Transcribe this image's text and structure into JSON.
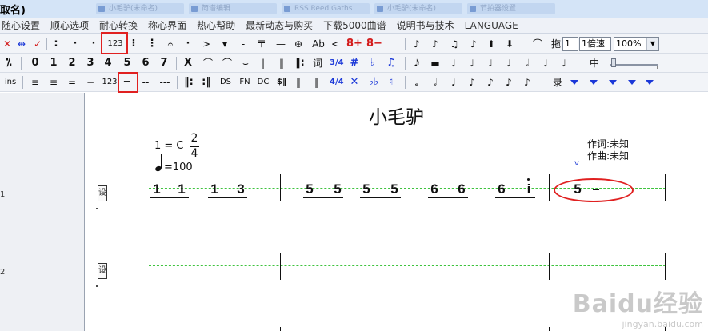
{
  "window": {
    "title": "取名)"
  },
  "ghost_tabs": [
    "小毛驴(未命名)",
    "简谱编辑",
    "RSS Reed Gaths",
    "小毛驴(未命名)",
    "节拍器设置"
  ],
  "menu": [
    "随心设置",
    "顺心选项",
    "耐心转换",
    "称心界面",
    "热心帮助",
    "最新动态与购买",
    "下载5000曲谱",
    "说明书与技术",
    "LANGUAGE"
  ],
  "toolbar1": {
    "left_icons": [
      "delete-x-icon",
      "cut-icon",
      "check-icon"
    ],
    "dots": [
      ":",
      "·",
      "·"
    ],
    "numbered_mode": "123",
    "marks": [
      "⁝",
      "⋮",
      "𝄐",
      "·",
      ">",
      "▾",
      "-",
      "〒",
      "—",
      "⊕",
      "Ab",
      "<"
    ],
    "octave_up": "8+",
    "octave_down": "8−",
    "drag_label": "拖",
    "drag_value": "1",
    "speed_value": "1倍速",
    "zoom": "100%"
  },
  "toolbar2": {
    "first": "⁒",
    "digits": [
      "0",
      "1",
      "2",
      "3",
      "4",
      "5",
      "6",
      "7"
    ],
    "marks": [
      "X",
      "⌒",
      "⌒",
      "⌣",
      "|",
      "‖",
      "‖:",
      "词",
      "3/4",
      "#",
      "♭",
      "♫"
    ],
    "voice_label": "中"
  },
  "toolbar3": {
    "ins": "ins",
    "lines": [
      "≡",
      "≡",
      "=",
      "−"
    ],
    "numbered_small": "123",
    "dash": "−",
    "dash2": "--",
    "dash3": "---",
    "marks": [
      "‖:",
      ":‖",
      "DS",
      "FN",
      "DC",
      "$‖",
      "‖",
      "‖",
      "4/4",
      "✕",
      "♭♭",
      "♮"
    ],
    "record_label": "录"
  },
  "score": {
    "title": "小毛驴",
    "key": "1 = C",
    "time_top": "2",
    "time_bottom": "4",
    "tempo": "=100",
    "lyricist": "作词:未知",
    "composer": "作曲:未知",
    "v_mark": "v",
    "clef_label": "设",
    "rows": [
      {
        "number": "1",
        "measures": [
          {
            "notes": [
              "1",
              "1",
              "1",
              "3"
            ]
          },
          {
            "notes": [
              "5",
              "5",
              "5",
              "5"
            ]
          },
          {
            "notes": [
              "6",
              "6",
              "6",
              "i"
            ]
          },
          {
            "notes": [
              "5",
              "–"
            ]
          }
        ]
      },
      {
        "number": "2",
        "measures": []
      }
    ]
  },
  "watermark": {
    "brand": "Baidu经验",
    "url": "jingyan.baidu.com"
  },
  "colors": {
    "highlight": "#e02020",
    "staff_guide": "#3ec33e",
    "blue_tool": "#1a37d8"
  }
}
